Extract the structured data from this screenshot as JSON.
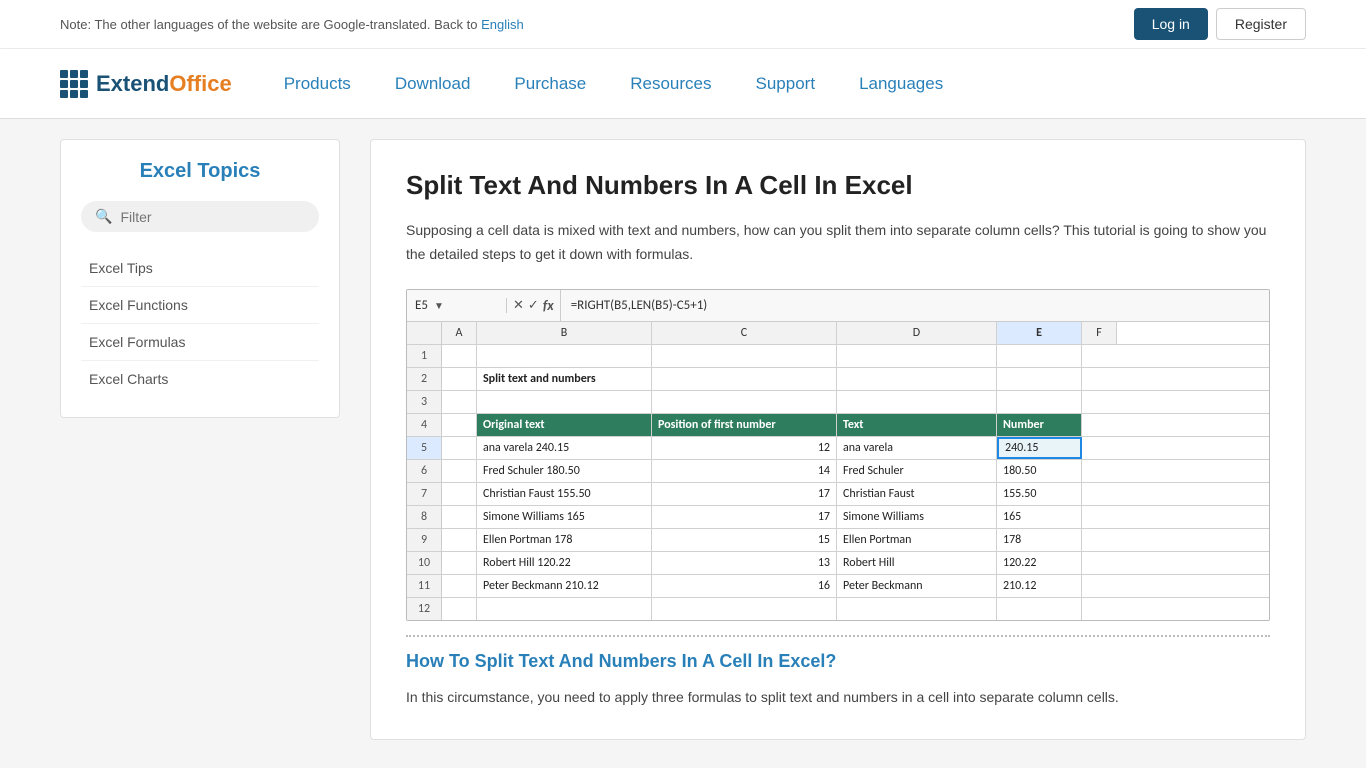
{
  "notice": {
    "text": "Note: The other languages of the website are Google-translated. Back to ",
    "link_text": "English",
    "link_href": "#"
  },
  "auth": {
    "login_label": "Log in",
    "register_label": "Register"
  },
  "logo": {
    "text_extend": "Extend",
    "text_office": "Office"
  },
  "nav": {
    "items": [
      {
        "label": "Products",
        "href": "#"
      },
      {
        "label": "Download",
        "href": "#"
      },
      {
        "label": "Purchase",
        "href": "#"
      },
      {
        "label": "Resources",
        "href": "#"
      },
      {
        "label": "Support",
        "href": "#"
      },
      {
        "label": "Languages",
        "href": "#"
      }
    ]
  },
  "sidebar": {
    "title": "Excel Topics",
    "filter_placeholder": "Filter",
    "links": [
      {
        "label": "Excel Tips"
      },
      {
        "label": "Excel Functions"
      },
      {
        "label": "Excel Formulas"
      },
      {
        "label": "Excel Charts"
      }
    ]
  },
  "article": {
    "title": "Split Text And Numbers In A Cell In Excel",
    "intro": "Supposing a cell data is mixed with text and numbers, how can you split them into separate column cells? This tutorial is going to show you the detailed steps to get it down with formulas.",
    "excel": {
      "cell_ref": "E5",
      "formula": "=RIGHT(B5,LEN(B5)-C5+1)",
      "col_headers": [
        "A",
        "B",
        "C",
        "D",
        "E",
        "F"
      ],
      "rows": [
        {
          "num": "1",
          "cells": [
            "",
            "",
            "",
            "",
            "",
            ""
          ]
        },
        {
          "num": "2",
          "cells": [
            "",
            "Split text and numbers",
            "",
            "",
            "",
            ""
          ]
        },
        {
          "num": "3",
          "cells": [
            "",
            "",
            "",
            "",
            "",
            ""
          ]
        },
        {
          "num": "4",
          "cells": [
            "",
            "Original text",
            "Position of first number",
            "Text",
            "Number",
            ""
          ],
          "header": true
        },
        {
          "num": "5",
          "cells": [
            "",
            "ana varela 240.15",
            "12",
            "ana varela",
            "240.15",
            ""
          ],
          "selected": true
        },
        {
          "num": "6",
          "cells": [
            "",
            "Fred Schuler 180.50",
            "14",
            "Fred Schuler",
            "180.50",
            ""
          ]
        },
        {
          "num": "7",
          "cells": [
            "",
            "Christian Faust 155.50",
            "17",
            "Christian Faust",
            "155.50",
            ""
          ]
        },
        {
          "num": "8",
          "cells": [
            "",
            "Simone Williams 165",
            "17",
            "Simone Williams",
            "165",
            ""
          ]
        },
        {
          "num": "9",
          "cells": [
            "",
            "Ellen Portman 178",
            "15",
            "Ellen Portman",
            "178",
            ""
          ]
        },
        {
          "num": "10",
          "cells": [
            "",
            "Robert Hill 120.22",
            "13",
            "Robert Hill",
            "120.22",
            ""
          ]
        },
        {
          "num": "11",
          "cells": [
            "",
            "Peter Beckmann 210.12",
            "16",
            "Peter Beckmann",
            "210.12",
            ""
          ]
        },
        {
          "num": "12",
          "cells": [
            "",
            "",
            "",
            "",
            "",
            ""
          ]
        }
      ]
    },
    "section2_title": "How To Split Text And Numbers In A Cell In Excel?",
    "section2_text": "In this circumstance, you need to apply three formulas to split text and numbers in a cell into separate column cells."
  }
}
